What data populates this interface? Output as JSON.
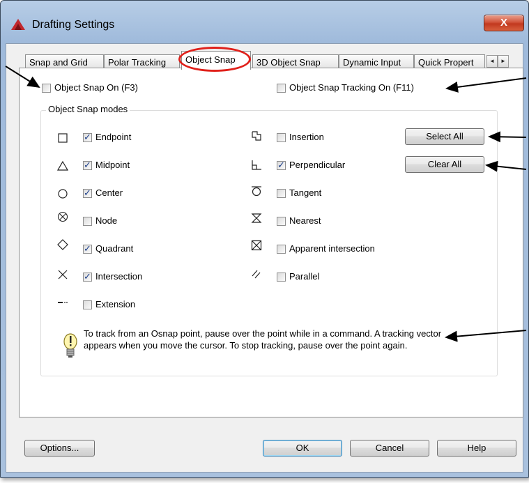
{
  "window": {
    "title": "Drafting Settings",
    "close_label": "X"
  },
  "tabs": [
    {
      "label": "Snap and Grid"
    },
    {
      "label": "Polar Tracking"
    },
    {
      "label": "Object Snap"
    },
    {
      "label": "3D Object Snap"
    },
    {
      "label": "Dynamic Input"
    },
    {
      "label": "Quick Propert"
    }
  ],
  "tab_scroll": {
    "left": "◄",
    "right": "►"
  },
  "toggles": {
    "osnap_on": {
      "label": "Object Snap On (F3)",
      "checked": false
    },
    "tracking_on": {
      "label": "Object Snap Tracking On (F11)",
      "checked": false
    }
  },
  "modes": {
    "group_title": "Object Snap modes",
    "left": [
      {
        "label": "Endpoint",
        "checked": true,
        "icon": "square-icon"
      },
      {
        "label": "Midpoint",
        "checked": true,
        "icon": "triangle-icon"
      },
      {
        "label": "Center",
        "checked": true,
        "icon": "circle-icon"
      },
      {
        "label": "Node",
        "checked": false,
        "icon": "node-icon"
      },
      {
        "label": "Quadrant",
        "checked": true,
        "icon": "diamond-icon"
      },
      {
        "label": "Intersection",
        "checked": true,
        "icon": "x-icon"
      },
      {
        "label": "Extension",
        "checked": false,
        "icon": "extension-icon"
      }
    ],
    "right": [
      {
        "label": "Insertion",
        "checked": false,
        "icon": "insertion-icon"
      },
      {
        "label": "Perpendicular",
        "checked": true,
        "icon": "perpendicular-icon"
      },
      {
        "label": "Tangent",
        "checked": false,
        "icon": "tangent-icon"
      },
      {
        "label": "Nearest",
        "checked": false,
        "icon": "hourglass-icon"
      },
      {
        "label": "Apparent intersection",
        "checked": false,
        "icon": "boxed-x-icon"
      },
      {
        "label": "Parallel",
        "checked": false,
        "icon": "parallel-icon"
      }
    ]
  },
  "side_buttons": {
    "select_all": "Select All",
    "clear_all": "Clear All"
  },
  "tip": {
    "text": "To track from an Osnap point, pause over the point while in a command.  A tracking vector appears when you move the cursor.  To stop tracking, pause over the point again.",
    "icon": "lightbulb-icon"
  },
  "footer": {
    "options": "Options...",
    "ok": "OK",
    "cancel": "Cancel",
    "help": "Help"
  },
  "colors": {
    "annotation": "#e0201a",
    "check": "#1d3f8a"
  }
}
